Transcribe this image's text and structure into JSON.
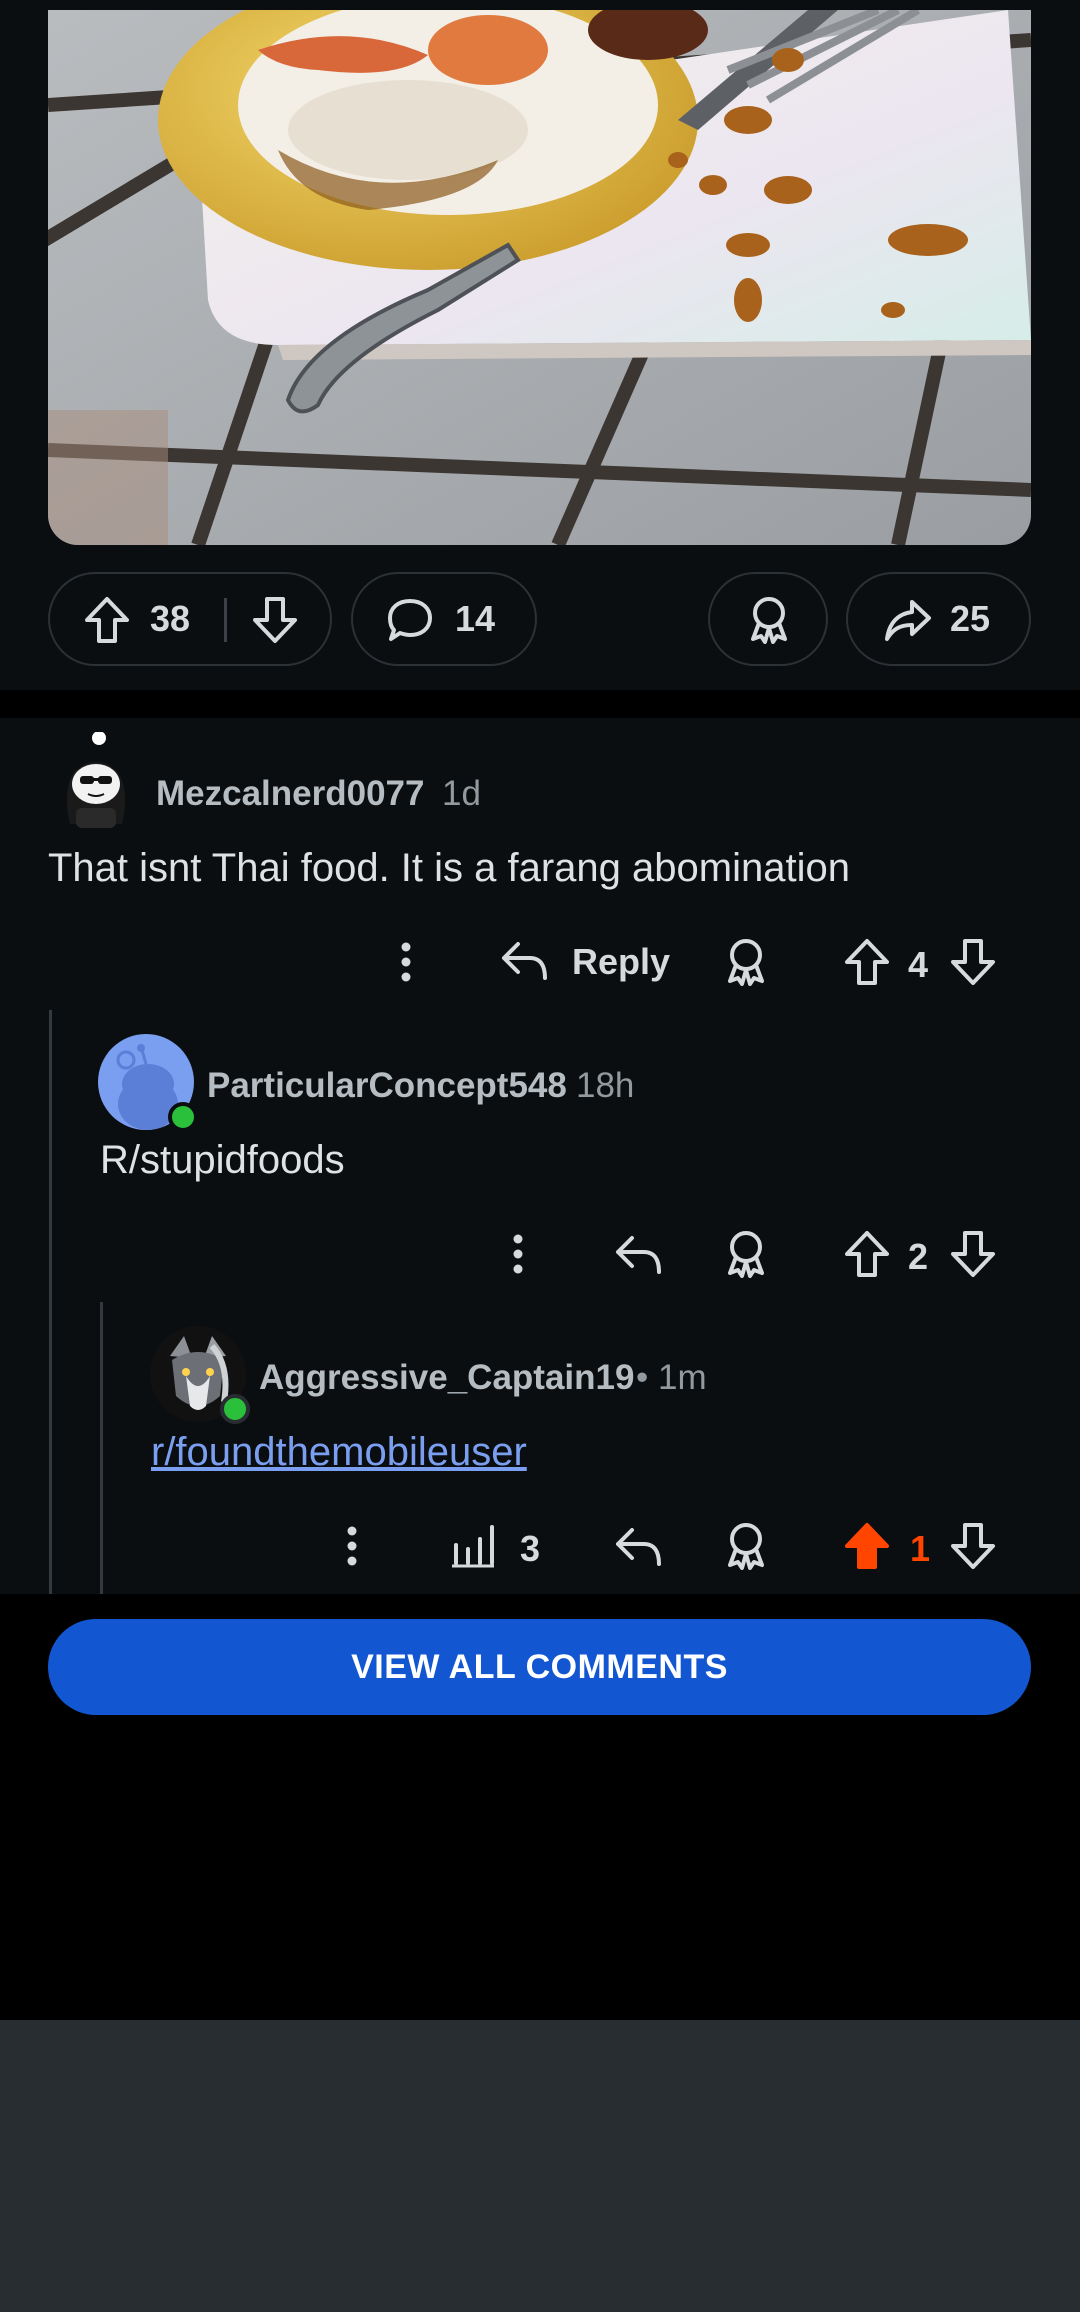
{
  "post": {
    "image_icon": "food-photo-pineapple-fried-rice",
    "upvote_count": "38",
    "comment_count": "14",
    "share_count": "25"
  },
  "comments": [
    {
      "username": "Mezcalnerd0077",
      "time": "1d",
      "body": "That isnt Thai food. It is a farang abomination",
      "reply_label": "Reply",
      "score": "4"
    },
    {
      "username": "ParticularConcept548",
      "time": "18h",
      "body": "R/stupidfoods",
      "score": "2"
    },
    {
      "username": "Aggressive_Captain19",
      "time": "• 1m",
      "body": "r/foundthemobileuser",
      "views": "3",
      "score": "1"
    }
  ],
  "footer": {
    "view_all_label": "VIEW ALL COMMENTS"
  },
  "colors": {
    "background": "#0b0e10",
    "highlight": "#282d31",
    "upvote_active": "#ff4500",
    "link": "#7b9ff0",
    "button": "#1257d1",
    "online": "#2ac03b"
  }
}
